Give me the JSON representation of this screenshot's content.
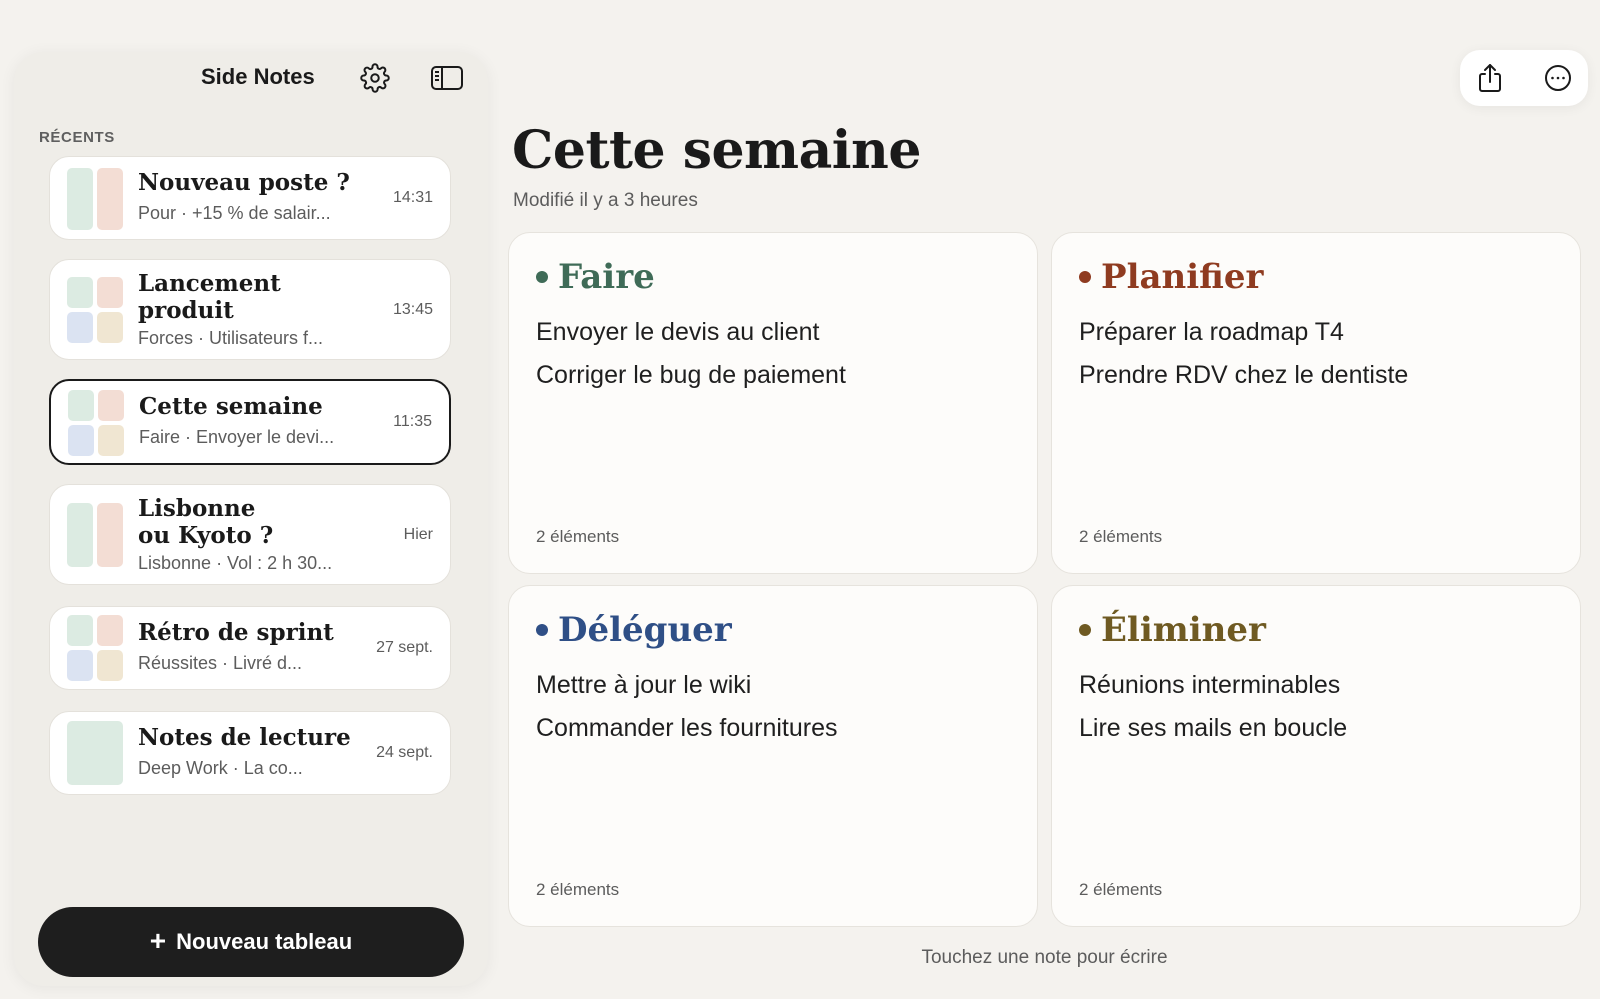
{
  "sidebar": {
    "title": "Side Notes",
    "settings_icon": "gear-icon",
    "toggle_icon": "sidebar-panel-icon",
    "section_label": "RÉCENTS",
    "notes": [
      {
        "title": "Nouveau poste ?",
        "subtitle": "Pour · +15 % de salair...",
        "time": "14:31",
        "thumb": "two-col"
      },
      {
        "title": "Lancement\nproduit",
        "subtitle": "Forces · Utilisateurs f...",
        "time": "13:45",
        "thumb": "four-grid"
      },
      {
        "title": "Cette semaine",
        "subtitle": "Faire · Envoyer le devi...",
        "time": "11:35",
        "thumb": "four-grid",
        "active": true
      },
      {
        "title": "Lisbonne\nou Kyoto ?",
        "subtitle": "Lisbonne · Vol : 2 h 30...",
        "time": "Hier",
        "thumb": "two-col"
      },
      {
        "title": "Rétro de sprint",
        "subtitle": "Réussites · Livré d...",
        "time": "27 sept.",
        "thumb": "four-grid"
      },
      {
        "title": "Notes de lecture",
        "subtitle": "Deep Work · La co...",
        "time": "24 sept.",
        "thumb": "single"
      }
    ],
    "new_button": {
      "icon": "plus-icon",
      "label": "Nouveau tableau"
    }
  },
  "toolbar": {
    "share_icon": "share-icon",
    "more_icon": "more-icon"
  },
  "main": {
    "title": "Cette semaine",
    "modified": "Modifié il y a 3 heures",
    "quadrants": [
      {
        "title": "Faire",
        "color": "#3f6b57",
        "items": [
          "Envoyer le devis au client",
          "Corriger le bug de paiement"
        ],
        "count": "2 éléments"
      },
      {
        "title": "Planifier",
        "color": "#8f3b20",
        "items": [
          "Préparer la roadmap T4",
          "Prendre RDV chez le dentiste"
        ],
        "count": "2 éléments"
      },
      {
        "title": "Déléguer",
        "color": "#2f4f86",
        "items": [
          "Mettre à jour le wiki",
          "Commander les fournitures"
        ],
        "count": "2 éléments"
      },
      {
        "title": "Éliminer",
        "color": "#6f5a22",
        "items": [
          "Réunions interminables",
          "Lire ses mails en boucle"
        ],
        "count": "2 éléments"
      }
    ],
    "hint": "Touchez une note pour écrire"
  },
  "colors": {
    "thumb_green": "#dcebe2",
    "thumb_peach": "#f3ddd4",
    "thumb_blue": "#dbe3f2",
    "thumb_sand": "#f0e6d2"
  }
}
